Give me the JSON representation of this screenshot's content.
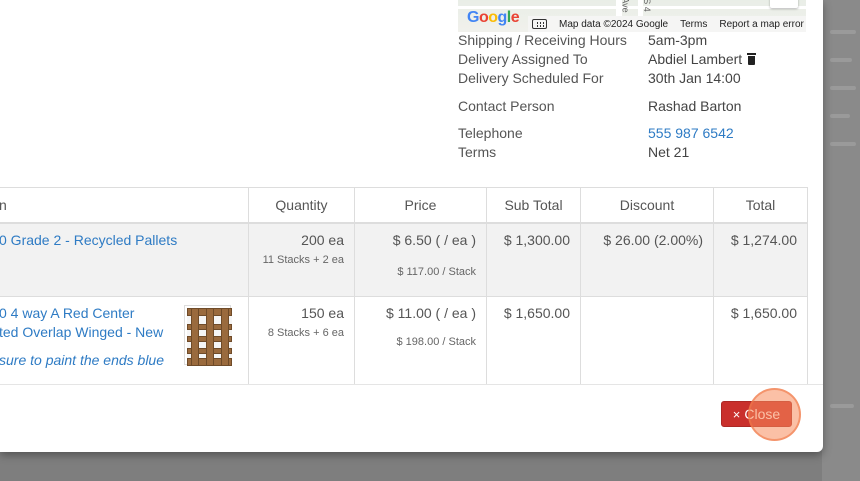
{
  "map": {
    "logo": "Google",
    "attribution": {
      "data": "Map data ©2024 Google",
      "terms": "Terms",
      "report": "Report a map error"
    },
    "street_labels": [
      "Ave",
      "S 4"
    ]
  },
  "info": {
    "shipping_hours": {
      "label": "Shipping / Receiving Hours",
      "value": "5am-3pm"
    },
    "delivery_assigned": {
      "label": "Delivery Assigned To",
      "value": "Abdiel Lambert"
    },
    "delivery_scheduled": {
      "label": "Delivery Scheduled For",
      "value": "30th Jan 14:00"
    },
    "contact_person": {
      "label": "Contact Person",
      "value": "Rashad Barton"
    },
    "telephone": {
      "label": "Telephone",
      "value": "555 987 6542"
    },
    "terms": {
      "label": "Terms",
      "value": "Net 21"
    }
  },
  "table": {
    "headers": {
      "item": "n",
      "quantity": "Quantity",
      "price": "Price",
      "subtotal": "Sub Total",
      "discount": "Discount",
      "total": "Total"
    },
    "rows": [
      {
        "product": "0 Grade 2 - Recycled Pallets",
        "quantity": "200 ea",
        "quantity_detail": "11 Stacks + 2 ea",
        "price": "$ 6.50 ( / ea )",
        "price_detail": "$ 117.00 / Stack",
        "subtotal": "$ 1,300.00",
        "discount": "$ 26.00 (2.00%)",
        "total": "$ 1,274.00"
      },
      {
        "product_line1": "0 4 way A Red Center",
        "product_line2": "ted Overlap Winged - New",
        "note": "sure to paint the ends blue",
        "quantity": "150 ea",
        "quantity_detail": "8 Stacks + 6 ea",
        "price": "$ 11.00 ( / ea )",
        "price_detail": "$ 198.00 / Stack",
        "subtotal": "$ 1,650.00",
        "discount": "",
        "total": "$ 1,650.00"
      }
    ]
  },
  "footer": {
    "close_label": "Close",
    "close_icon": "×"
  },
  "colors": {
    "link": "#2e7bc4",
    "danger": "#c9302c",
    "backdrop": "#7e7e7e"
  }
}
